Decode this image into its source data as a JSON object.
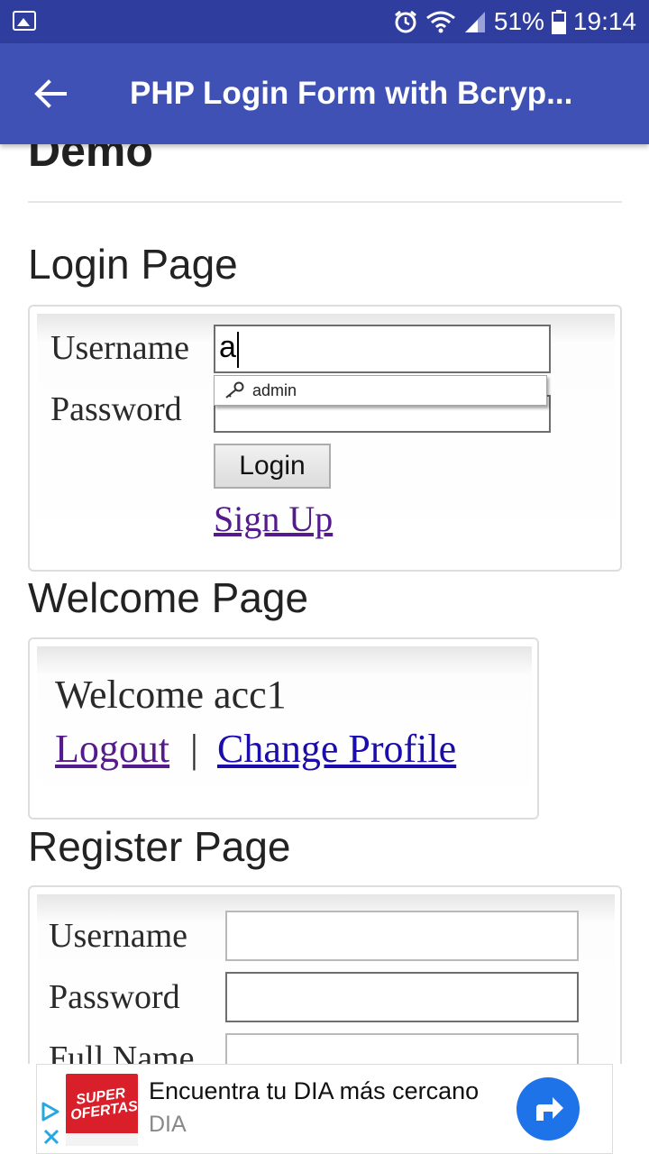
{
  "status_bar": {
    "battery": "51%",
    "time": "19:14",
    "icons": [
      "gallery-icon",
      "alarm-icon",
      "wifi-icon",
      "signal-icon",
      "battery-icon"
    ]
  },
  "app_bar": {
    "title": "PHP Login Form with Bcryp...",
    "back_icon": "arrow-back-icon",
    "background": "#3f51b5",
    "status_background": "#2f3e9e"
  },
  "content": {
    "demo_heading": "Demo",
    "login_section": {
      "title": "Login Page",
      "username_label": "Username",
      "username_value": "a",
      "password_label": "Password",
      "autocomplete_suggestion": "admin",
      "login_button": "Login",
      "signup_link": "Sign Up"
    },
    "welcome_section": {
      "title": "Welcome Page",
      "welcome_text": "Welcome acc1",
      "logout_link": "Logout",
      "separator": "|",
      "change_profile_link": "Change Profile"
    },
    "register_section": {
      "title": "Register Page",
      "username_label": "Username",
      "password_label": "Password",
      "fullname_label": "Full Name"
    }
  },
  "ad": {
    "image_text": "SUPER OFERTAS",
    "headline": "Encuentra tu DIA más cercano",
    "advertiser": "DIA",
    "cta_icon": "directions-arrow-icon",
    "cta_color": "#1e73e8"
  }
}
